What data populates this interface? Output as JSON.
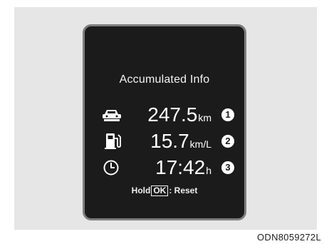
{
  "screen": {
    "title": "Accumulated Info",
    "rows": [
      {
        "icon": "car-route-icon",
        "value": "247.5",
        "unit": "km",
        "callout": "1"
      },
      {
        "icon": "fuel-pump-icon",
        "value": "15.7",
        "unit": "km/L",
        "callout": "2"
      },
      {
        "icon": "clock-icon",
        "value": "17:42",
        "unit": "h",
        "callout": "3"
      }
    ],
    "reset_hint": {
      "prefix": "Hold",
      "key": "OK",
      "suffix": ": Reset"
    }
  },
  "figure_code": "ODN8059272L",
  "colors": {
    "screen_bg": "#1b1b1b",
    "screen_border": "#7e7e7e",
    "frame_bg": "#e6e6e6",
    "text": "#ffffff"
  }
}
